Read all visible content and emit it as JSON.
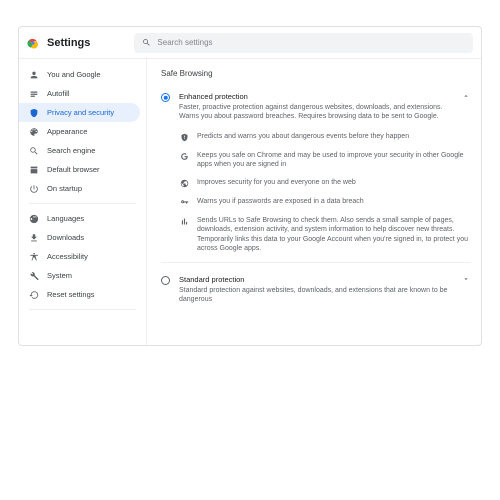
{
  "header": {
    "title": "Settings",
    "search_placeholder": "Search settings"
  },
  "sidebar": {
    "items": [
      {
        "label": "You and Google"
      },
      {
        "label": "Autofill"
      },
      {
        "label": "Privacy and security"
      },
      {
        "label": "Appearance"
      },
      {
        "label": "Search engine"
      },
      {
        "label": "Default browser"
      },
      {
        "label": "On startup"
      }
    ],
    "items2": [
      {
        "label": "Languages"
      },
      {
        "label": "Downloads"
      },
      {
        "label": "Accessibility"
      },
      {
        "label": "System"
      },
      {
        "label": "Reset settings"
      }
    ]
  },
  "main": {
    "section_title": "Safe Browsing",
    "enhanced": {
      "title": "Enhanced protection",
      "desc": "Faster, proactive protection against dangerous websites, downloads, and extensions. Warns you about password breaches. Requires browsing data to be sent to Google.",
      "features": [
        "Predicts and warns you about dangerous events before they happen",
        "Keeps you safe on Chrome and may be used to improve your security in other Google apps when you are signed in",
        "Improves security for you and everyone on the web",
        "Warns you if passwords are exposed in a data breach",
        "Sends URLs to Safe Browsing to check them. Also sends a small sample of pages, downloads, extension activity, and system information to help discover new threats. Temporarily links this data to your Google Account when you're signed in, to protect you across Google apps."
      ]
    },
    "standard": {
      "title": "Standard protection",
      "desc": "Standard protection against websites, downloads, and extensions that are known to be dangerous"
    }
  }
}
